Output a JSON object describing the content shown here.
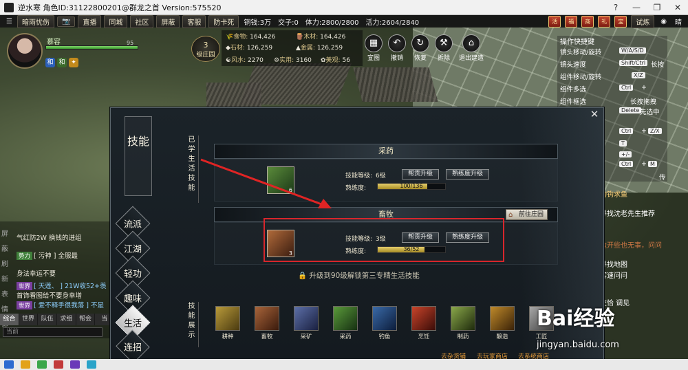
{
  "window": {
    "title": "逆水寒 角色ID:31122800201@群龙之首 Version:575520",
    "controls": [
      "?",
      "—",
      "❐",
      "✕"
    ]
  },
  "menubar": {
    "items": [
      "暗雨忧伤",
      "📷",
      "直播",
      "同城",
      "社区",
      "屏蔽",
      "客服",
      "防卡死"
    ],
    "copper": "铜钱:3万",
    "jiaozi": "交子:0",
    "stamina": "体力:2800/2800",
    "vitality": "活力:2604/2840",
    "right_items": [
      "试炼",
      "晴"
    ]
  },
  "player": {
    "name": "慕容",
    "level": "95",
    "hp_fraction": 1.0,
    "badges": [
      "和",
      "和",
      "✦"
    ]
  },
  "manor": {
    "level": "3",
    "label": "级庄园"
  },
  "resources": {
    "food": {
      "label": "食物:",
      "value": "164,426"
    },
    "wood": {
      "label": "木材:",
      "value": "164,426"
    },
    "stone": {
      "label": "石材:",
      "value": "126,259"
    },
    "metal": {
      "label": "金属:",
      "value": "126,259"
    },
    "fengshui": {
      "label": "风水:",
      "value": "2270"
    },
    "practical": {
      "label": "实用:",
      "value": "3160"
    },
    "beauty": {
      "label": "美观:",
      "value": "56"
    }
  },
  "buildtools": [
    {
      "label": "宣图",
      "icon": "map-icon"
    },
    {
      "label": "撤销",
      "icon": "undo-icon"
    },
    {
      "label": "恢复",
      "icon": "redo-icon"
    },
    {
      "label": "拆除",
      "icon": "hammer-icon"
    },
    {
      "label": "退出建造",
      "icon": "exit-build-icon"
    }
  ],
  "hotkeys": {
    "title": "操作快捷键",
    "rows": [
      {
        "label": "镜头移动/旋转",
        "keys": [
          "W/A/S/D"
        ]
      },
      {
        "label": "镜头速度",
        "keys": [
          "Shift/Ctrl",
          "长按"
        ]
      },
      {
        "label": "组件移动/旋转",
        "keys": [
          "X/Z"
        ]
      },
      {
        "label": "组件多选",
        "keys": [
          "Ctrl",
          "+"
        ]
      },
      {
        "label": "组件框选",
        "keys": [
          "长按拖拽"
        ]
      },
      {
        "label": "",
        "keys": [
          "Delete",
          "先选中"
        ]
      },
      {
        "label": "",
        "keys": [
          "Ctrl",
          "+",
          "Z/X"
        ]
      },
      {
        "label": "",
        "keys": [
          "T"
        ]
      },
      {
        "label": "",
        "keys": [
          "+/-"
        ]
      },
      {
        "label": "",
        "keys": [
          "Ctrl",
          "+",
          "M"
        ]
      }
    ],
    "extra": "传"
  },
  "chat": {
    "lines": [
      {
        "text": "气红防2W 换钱的进组"
      },
      {
        "tag": "势力",
        "tag_color": "#3f7f3a",
        "text": "[ 污神 ] 全服最"
      },
      {
        "text": "身法幸运不要"
      },
      {
        "tag": "世界",
        "tag_color": "#7a3fa0",
        "text": "[ 天莲、 ] 21W收52+羡"
      },
      {
        "text": "首饰看图给不要身幸增"
      },
      {
        "tag": "世界",
        "tag_color": "#7a3fa0",
        "text": "[ 爱不释手很我落 ] 不是"
      }
    ],
    "side_actions": [
      "屏",
      "蔽",
      "刷",
      "新",
      "表",
      "情",
      "饰"
    ],
    "tabs": [
      "综合",
      "世界",
      "队伍",
      "求组",
      "帮会",
      "当"
    ],
    "active_tab": 0,
    "input_placeholder": "当前"
  },
  "panel": {
    "title": "技能",
    "close": "✕",
    "nav": [
      "流派",
      "江湖",
      "轻功",
      "趣味",
      "生活",
      "连招"
    ],
    "active_nav": 4,
    "learned_label": "已学生活技能",
    "showcase_label": "技能展示",
    "skills": [
      {
        "name": "采药",
        "level_label": "技能等级:",
        "level": "6级",
        "btn_contrib": "帮贡升级",
        "btn_mastery": "熟练度升级",
        "mastery_label": "熟练度:",
        "mastery_text": "100/136",
        "mastery_fraction": 0.735,
        "icon_level": "6"
      },
      {
        "name": "畜牧",
        "level_label": "技能等级:",
        "level": "3级",
        "btn_contrib": "帮贡升级",
        "btn_mastery": "熟练度升级",
        "mastery_label": "熟练度:",
        "mastery_text": "36/52",
        "mastery_fraction": 0.692,
        "icon_level": "3"
      }
    ],
    "goto_manor": "前往庄园",
    "unlock_notice": "升级到90级解锁第三专精生活技能",
    "showcase": [
      "耕种",
      "畜牧",
      "采矿",
      "采药",
      "钓鱼",
      "烹饪",
      "制药",
      "酿造",
      "工匠"
    ],
    "links": [
      "去杂货铺",
      "去玩家商店",
      "去系统商店"
    ]
  },
  "npc": {
    "lines": [
      "询钩求鱼",
      "寻找沈老先生推荐",
      "边开些也无事，问问",
      "寻找地图",
      "客速问问",
      "交恰 调见"
    ]
  },
  "watermark": {
    "brand": "Bai经验",
    "url": "jingyan.baidu.com"
  }
}
